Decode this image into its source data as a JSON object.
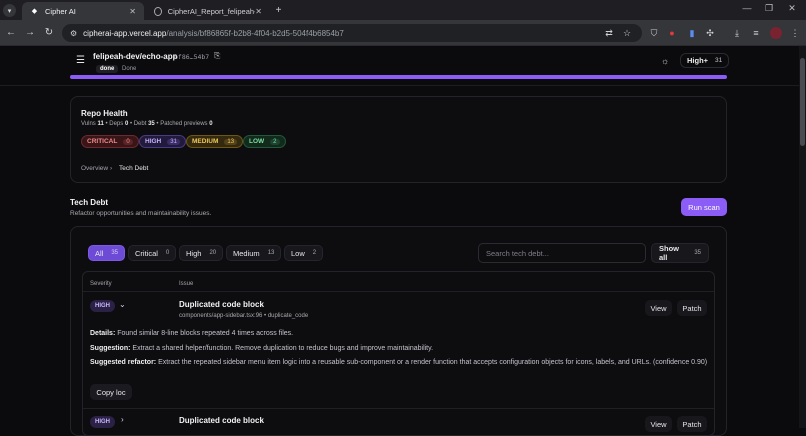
{
  "browser": {
    "tabs": [
      {
        "title": "Cipher AI",
        "active": true,
        "favicon": "cipher-logo-icon"
      },
      {
        "title": "CipherAI_Report_felipeah-dev...",
        "active": false,
        "favicon": "globe-icon"
      }
    ],
    "url_host": "cipherai-app.vercel.app",
    "url_path": "/analysis/bf86865f-b2b8-4f04-b2d5-504f4b6854b7"
  },
  "header": {
    "repo": "felipeah-dev/echo-app",
    "sha": "bf86…54b7",
    "status_badge": "done",
    "status_text": "Done",
    "progress_percent": 100,
    "severity_label": "High+",
    "severity_count": "31"
  },
  "repo_health": {
    "title": "Repo Health",
    "meta": {
      "vulns_label": "Vulns",
      "vulns": "11",
      "deps_label": "Deps",
      "deps": "0",
      "debt_label": "Debt",
      "debt": "35",
      "patched_label": "Patched previews",
      "patched": "0"
    },
    "severities": [
      {
        "label": "CRITICAL",
        "count": "0"
      },
      {
        "label": "HIGH",
        "count": "31"
      },
      {
        "label": "MEDIUM",
        "count": "13"
      },
      {
        "label": "LOW",
        "count": "2"
      }
    ],
    "breadcrumb": {
      "root": "Overview",
      "current": "Tech Debt"
    }
  },
  "tech_debt": {
    "title": "Tech Debt",
    "subtitle": "Refactor opportunities and maintainability issues.",
    "run_scan": "Run scan",
    "filters": [
      {
        "label": "All",
        "count": "35",
        "active": true
      },
      {
        "label": "Critical",
        "count": "0"
      },
      {
        "label": "High",
        "count": "20"
      },
      {
        "label": "Medium",
        "count": "13"
      },
      {
        "label": "Low",
        "count": "2"
      }
    ],
    "search_placeholder": "Search tech debt...",
    "show_all": "Show all",
    "show_all_count": "35",
    "columns": {
      "severity": "Severity",
      "issue": "Issue"
    },
    "rows": [
      {
        "severity": "HIGH",
        "title": "Duplicated code block",
        "location": "components/app-sidebar.tsx:96 • duplicate_code",
        "view": "View",
        "patch": "Patch",
        "details_label": "Details:",
        "details": "Found similar 8-line blocks repeated 4 times across files.",
        "suggestion_label": "Suggestion:",
        "suggestion": "Extract a shared helper/function. Remove duplication to reduce bugs and improve maintainability.",
        "refactor_label": "Suggested refactor:",
        "refactor": "Extract the repeated sidebar menu item logic into a reusable sub-component or a render function that accepts configuration objects for icons, labels, and URLs. (confidence 0.90)",
        "copy_loc": "Copy loc"
      },
      {
        "severity": "HIGH",
        "title": "Duplicated code block",
        "view": "View",
        "patch": "Patch"
      }
    ]
  }
}
